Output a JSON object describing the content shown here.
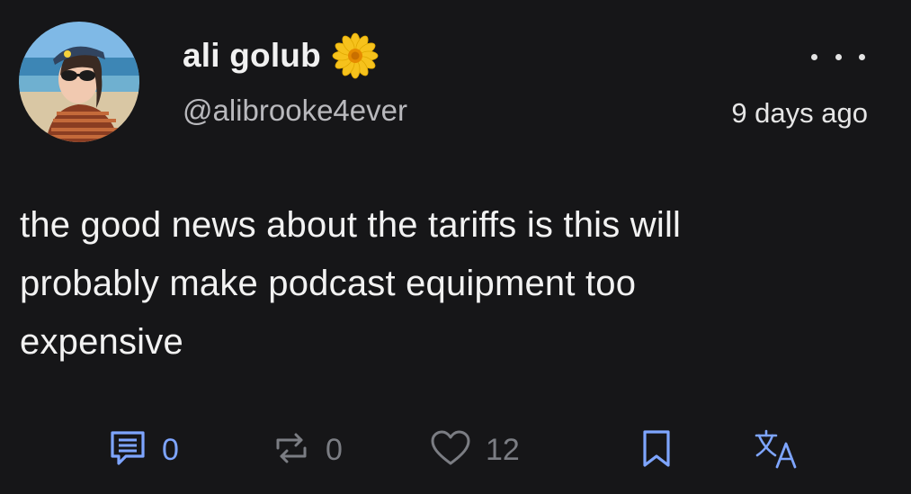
{
  "post": {
    "display_name": "ali golub",
    "handle": "@alibrooke4ever",
    "timestamp": "9 days ago",
    "text_lines": [
      "the good news about the tariffs is this will",
      "probably make podcast equipment too",
      "expensive"
    ],
    "name_emoji": "sunflower-icon"
  },
  "actions": {
    "reply_count": "0",
    "repost_count": "0",
    "like_count": "12"
  },
  "colors": {
    "background": "#161618",
    "accent_blue": "#7ea5ff",
    "muted_gray": "#7b7d83",
    "flower_petal": "#f6c21c",
    "flower_center": "#e68a00"
  }
}
